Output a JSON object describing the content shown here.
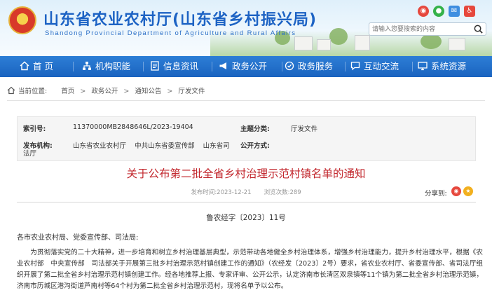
{
  "header": {
    "title": "山东省农业农村厅(山东省乡村振兴局)",
    "subtitle": "Shandong Provincial Department of Agriculture and Rural Affairs",
    "search_placeholder": "请输入您要搜索的内容",
    "social_icons": [
      "weibo-icon",
      "wechat-icon",
      "mail-icon",
      "accessibility-icon"
    ],
    "colors": {
      "title": "#1d63c4",
      "nav": "#1a63bf"
    }
  },
  "nav": {
    "items": [
      {
        "label": "首  页",
        "icon": "home-icon"
      },
      {
        "label": "机构职能",
        "icon": "org-icon"
      },
      {
        "label": "信息资讯",
        "icon": "document-icon"
      },
      {
        "label": "政务公开",
        "icon": "megaphone-icon"
      },
      {
        "label": "政务服务",
        "icon": "service-icon"
      },
      {
        "label": "互动交流",
        "icon": "chat-icon"
      },
      {
        "label": "系统资源",
        "icon": "system-icon"
      }
    ]
  },
  "breadcrumb": {
    "prefix": "当前位置:",
    "items": [
      "首页",
      "政务公开",
      "通知公告",
      "厅发文件"
    ],
    "separator": ">"
  },
  "meta": {
    "index_label": "索引号:",
    "index_value": "11370000MB2848646L/2023-19404",
    "topic_label": "主题分类:",
    "topic_value": "厅发文件",
    "issuer_label": "发布机构:",
    "issuer_value": "山东省农业农村厅    中共山东省委宣传部    山东省司",
    "issuer_value_cont": "法厅",
    "open_label": "公开方式:",
    "open_value": ""
  },
  "article": {
    "title": "关于公布第二批全省乡村治理示范村镇名单的通知",
    "date": "发布时间:2023-12-21",
    "views": "浏览次数:289",
    "share_label": "分享到:",
    "doc_number": "鲁农经字〔2023〕11号",
    "recipients": "各市农业农村局、党委宣传部、司法局:",
    "body": "为贯彻落实党的二十大精神，进一步培育和树立乡村治理基层典型，示范带动各地健全乡村治理体系，增强乡村治理能力，提升乡村治理水平，根据《农业农村部　中央宣传部　司法部关于开展第三批乡村治理示范村镇创建工作的通知》（农经发〔2023〕2号）要求，省农业农村厅、省委宣传部、省司法厅组织开展了第二批全省乡村治理示范村镇创建工作。经各地推荐上报、专家评审、公开公示，认定济南市长清区双泉镇等11个镇为第二批全省乡村治理示范镇，济南市历城区港沟街道芦南村等64个村为第二批全省乡村治理示范村，现将名单予以公布。",
    "title_color": "#c2272d"
  }
}
